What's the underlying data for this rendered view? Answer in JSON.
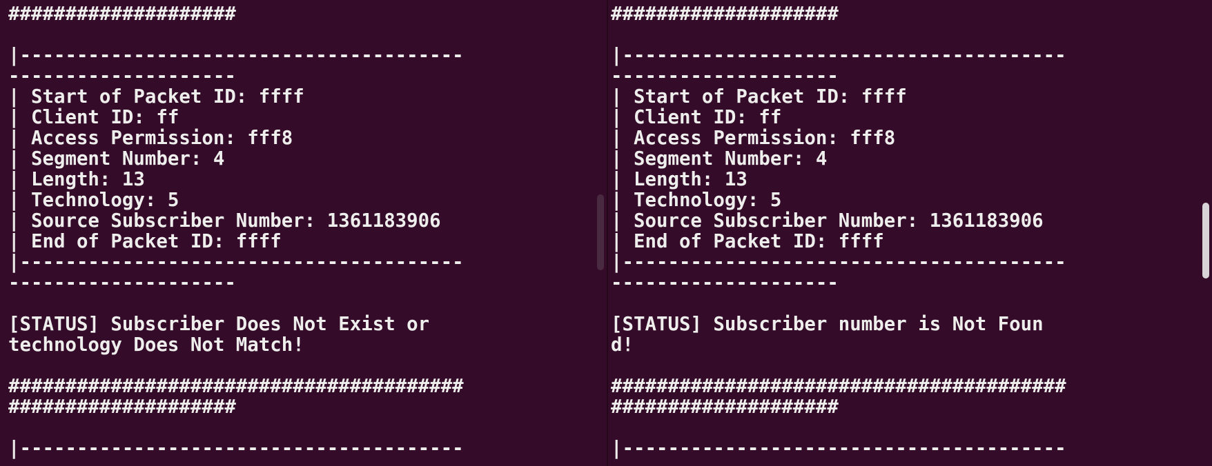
{
  "left_pane": {
    "lines": [
      "########################################",
      "####################",
      "",
      "|---------------------------------------",
      "--------------------",
      "| Start of Packet ID: ffff",
      "| Client ID: ff",
      "| Access Permission: fff8",
      "| Segment Number: 4",
      "| Length: 13",
      "| Technology: 5",
      "| Source Subscriber Number: 1361183906",
      "| End of Packet ID: ffff",
      "|---------------------------------------",
      "--------------------",
      "",
      "[STATUS] Subscriber Does Not Exist or",
      "technology Does Not Match!",
      "",
      "########################################",
      "####################",
      "",
      "|---------------------------------------"
    ]
  },
  "right_pane": {
    "lines": [
      "########################################",
      "####################",
      "",
      "|---------------------------------------",
      "--------------------",
      "| Start of Packet ID: ffff",
      "| Client ID: ff",
      "| Access Permission: fff8",
      "| Segment Number: 4",
      "| Length: 13",
      "| Technology: 5",
      "| Source Subscriber Number: 1361183906",
      "| End of Packet ID: ffff",
      "|---------------------------------------",
      "--------------------",
      "",
      "[STATUS] Subscriber number is Not Foun",
      "d!",
      "",
      "########################################",
      "####################",
      "",
      "|---------------------------------------"
    ]
  },
  "colors": {
    "background": "#300a24",
    "text": "#eeeeec"
  }
}
